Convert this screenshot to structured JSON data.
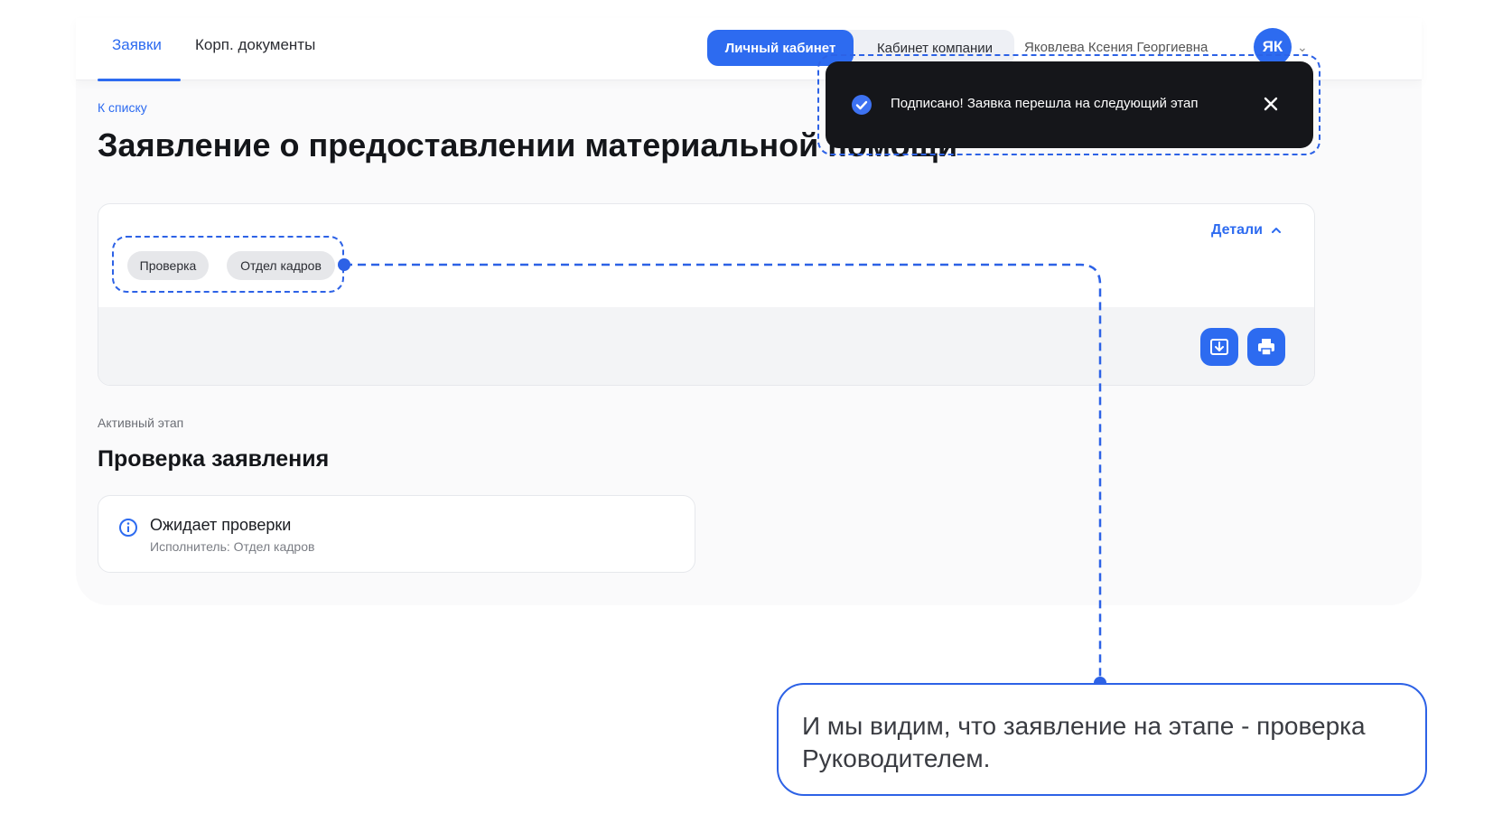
{
  "nav": {
    "tabs": [
      {
        "label": "Заявки",
        "active": true
      },
      {
        "label": "Корп. документы",
        "active": false
      }
    ],
    "account_switch": {
      "personal": "Личный кабинет",
      "company": "Кабинет компании"
    },
    "user_name": "Яковлева Ксения Георгиевна",
    "avatar_initials": "ЯК"
  },
  "page": {
    "back_link": "К списку",
    "title": "Заявление о предоставлении материальной помощи"
  },
  "request_card": {
    "tags": [
      "Проверка",
      "Отдел кадров"
    ],
    "details_label": "Детали",
    "actions": [
      {
        "icon": "download-icon"
      },
      {
        "icon": "print-icon"
      }
    ]
  },
  "active_stage": {
    "label": "Активный этап",
    "title": "Проверка заявления",
    "status": "Ожидает проверки",
    "executor": "Исполнитель: Отдел кадров"
  },
  "toast": {
    "message": "Подписано! Заявка перешла на следующий этап",
    "icon": "check-circle-icon"
  },
  "annotation": {
    "callout_text": "И мы видим, что заявление на этапе - проверка Руководителем."
  },
  "colors": {
    "accent": "#2d6bf0",
    "annotation": "#2d62e6",
    "toast_bg": "#15161a"
  }
}
